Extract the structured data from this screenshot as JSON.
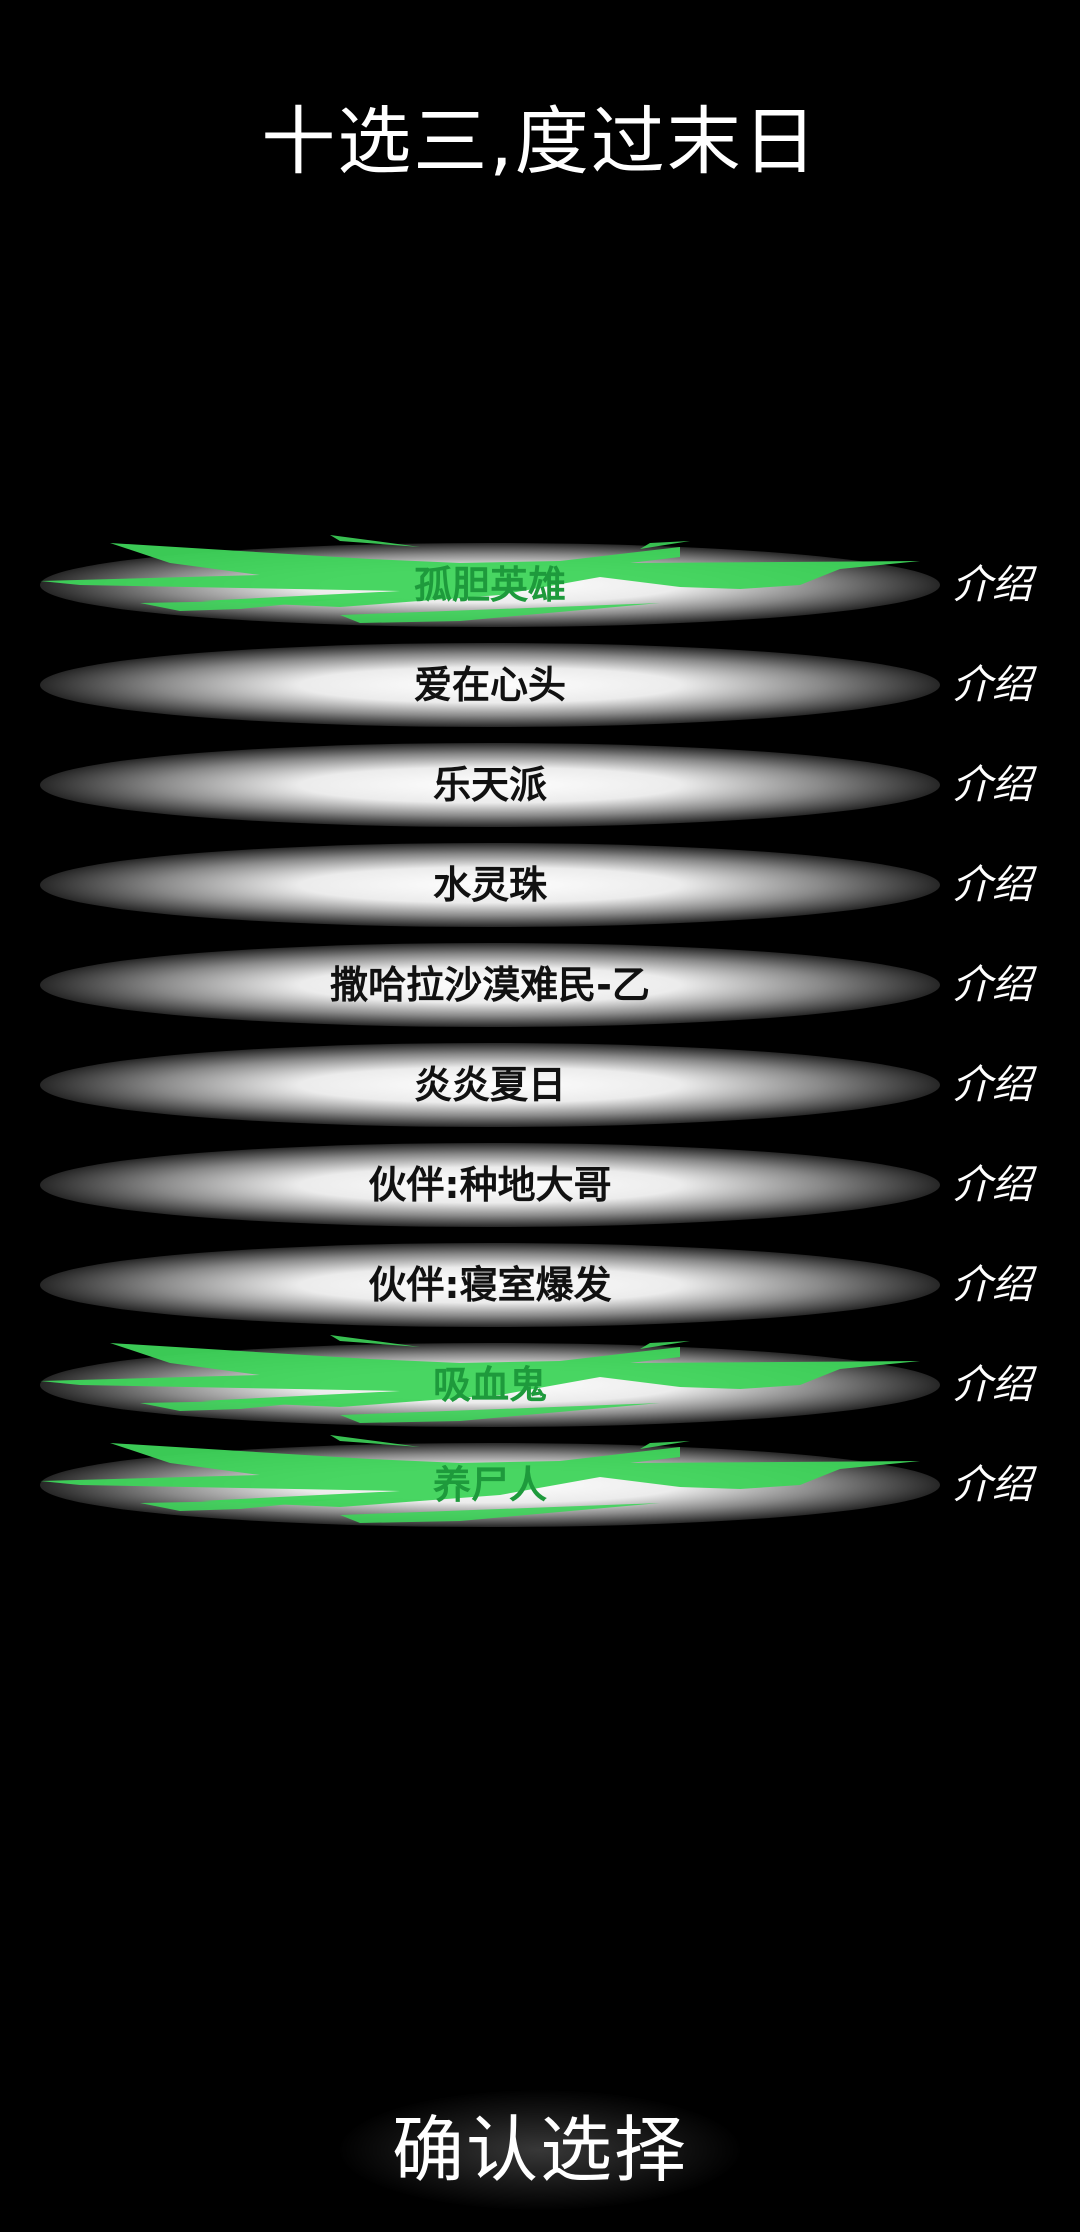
{
  "title": "十选三,度过末日",
  "intro_label": "介绍",
  "options": [
    {
      "name": "孤胆英雄",
      "selected": true
    },
    {
      "name": "爱在心头",
      "selected": false
    },
    {
      "name": "乐天派",
      "selected": false
    },
    {
      "name": "水灵珠",
      "selected": false
    },
    {
      "name": "撒哈拉沙漠难民-乙",
      "selected": false
    },
    {
      "name": "炎炎夏日",
      "selected": false
    },
    {
      "name": "伙伴:种地大哥",
      "selected": false
    },
    {
      "name": "伙伴:寝室爆发",
      "selected": false
    },
    {
      "name": "吸血鬼",
      "selected": true
    },
    {
      "name": "养尸人",
      "selected": true
    }
  ],
  "confirm_label": "确认选择",
  "colors": {
    "background": "#000000",
    "selected_brush": "#3ed45a",
    "selected_text": "#1e9a3c",
    "option_text": "#111111",
    "text_light": "#ffffff"
  }
}
